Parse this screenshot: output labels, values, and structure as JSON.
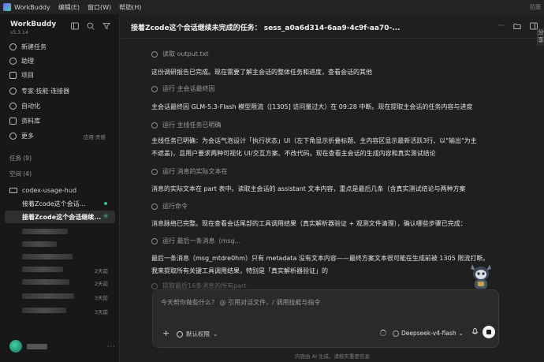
{
  "titlebar": {
    "app_name": "WorkBuddy",
    "menus": [
      "编辑(E)",
      "窗口(W)",
      "帮助(H)"
    ],
    "right_text": "拉面"
  },
  "sidebar": {
    "brand": "WorkBuddy",
    "version": "v5.3.14",
    "nav": [
      {
        "label": "新建任务",
        "icon": "plus-icon"
      },
      {
        "label": "助理",
        "icon": "assistant-icon"
      },
      {
        "label": "项目",
        "icon": "project-icon"
      },
      {
        "label": "专家·技能·连接器",
        "icon": "expert-icon"
      },
      {
        "label": "自动化",
        "icon": "automation-icon"
      },
      {
        "label": "资料库",
        "icon": "library-icon"
      },
      {
        "label": "更多",
        "icon": "more-icon",
        "extra": "应用·灵感"
      }
    ],
    "tasks_section": "任务 (9)",
    "spaces_section": "空间 (4)",
    "folder": "codex-usage-hud",
    "tasks": [
      {
        "label": "接着Zcode这个会话...",
        "status": "dot"
      },
      {
        "label": "接着Zcode这个会话继续...",
        "status": "running"
      }
    ],
    "blurred_meta": [
      "",
      "",
      "",
      "2天前",
      "2天前",
      "3天前",
      "3天前"
    ]
  },
  "main": {
    "title": "接着Zcode这个会话继续未完成的任务：  sess_a0a6d314-6aa9-4c9f-aa70-...",
    "peek_text": "分享",
    "lines": [
      {
        "kind": "step",
        "text": "读取 output.txt"
      },
      {
        "kind": "text",
        "text": "这份调研报告已完成。现在需要了解主会话的整体任务和进度，查看会话的其他"
      },
      {
        "kind": "step",
        "text": "运行 主会话最终因"
      },
      {
        "kind": "text",
        "text": "主会话最终因 GLM-5.3-Flash 模型限流（[1305] 访问量过大）在 09:28 中断。现在提取主会话的任务内容与进度"
      },
      {
        "kind": "step",
        "text": "运行 主线任务已明确"
      },
      {
        "kind": "text",
        "text": "主线任务已明确：为会话气泡设计「执行状态」UI（左下角显示折叠标题、主内容区显示最新活跃3行、以\"输出\"为主"
      },
      {
        "kind": "text",
        "text": "不遮盖)，且用户要求两种可视化 UI/交互方案、不改代码。现在查看主会话的生成内容和真实测试结论"
      },
      {
        "kind": "step",
        "text": "运行 消息的实际文本在"
      },
      {
        "kind": "text",
        "text": "消息的实际文本在 part 表中。读取主会话的 assistant 文本内容，重点是最后几条（含真实测试结论与两种方案"
      },
      {
        "kind": "step",
        "text": "运行命令"
      },
      {
        "kind": "text",
        "text": "消息脉络已完整。现在查看会话尾部的工具调用结果（真实解析器验证 + 观测文件清理），确认哪些步骤已完成："
      },
      {
        "kind": "step",
        "text": "运行 最后一条消息（msg..."
      },
      {
        "kind": "text",
        "text": "最后一条消息（msg_mtdre0hm）只有 metadata 没有文本内容——最终方案文本很可能在生成前被 1305 限流打断。"
      },
      {
        "kind": "text",
        "text": "我来提取所有关键工具调用结果，特别是「真实解析器验证」的"
      },
      {
        "kind": "step",
        "text": "提取最后16条消息的所有part"
      }
    ]
  },
  "composer": {
    "placeholder": "今天帮你做些什么？ @ 引用对话文件，/ 调用技能与指令",
    "permission_label": "默认权限",
    "model_label": "Deepseek-v4-flash"
  },
  "footer": "内容由 AI 生成，请核实重要信息"
}
